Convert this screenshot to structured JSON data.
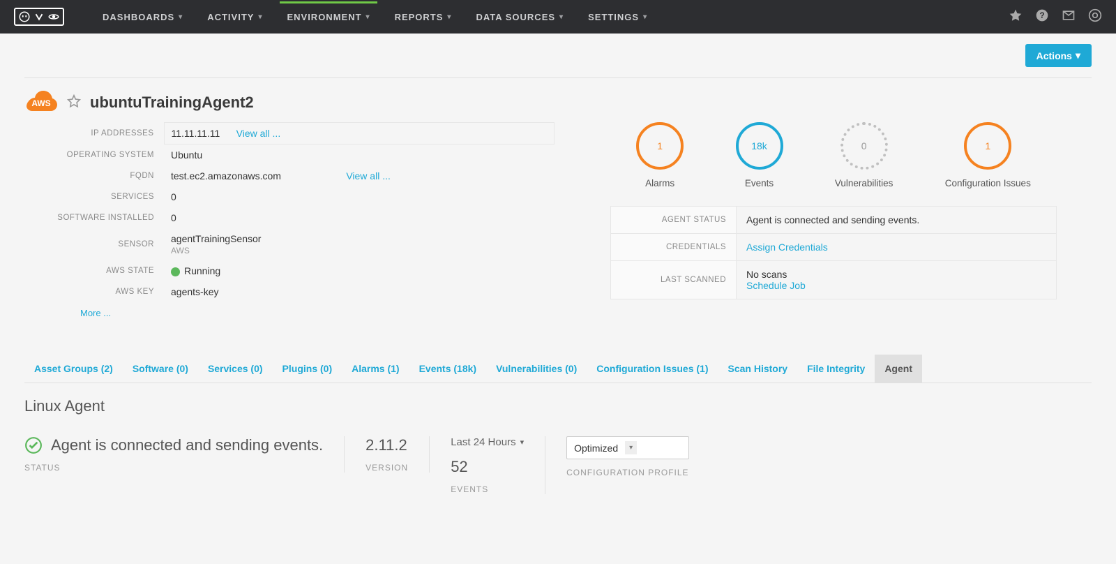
{
  "nav": {
    "items": [
      "DASHBOARDS",
      "ACTIVITY",
      "ENVIRONMENT",
      "REPORTS",
      "DATA SOURCES",
      "SETTINGS"
    ],
    "active": "ENVIRONMENT"
  },
  "actions_label": "Actions",
  "asset": {
    "name": "ubuntuTrainingAgent2",
    "cloud_badge": "AWS",
    "details": {
      "ip_label": "IP ADDRESSES",
      "ip_value": "11.11.11.11",
      "ip_viewall": "View all ...",
      "os_label": "OPERATING SYSTEM",
      "os_value": "Ubuntu",
      "fqdn_label": "FQDN",
      "fqdn_value": "test.ec2.amazonaws.com",
      "fqdn_viewall": "View all ...",
      "services_label": "SERVICES",
      "services_value": "0",
      "software_label": "SOFTWARE INSTALLED",
      "software_value": "0",
      "sensor_label": "SENSOR",
      "sensor_value": "agentTrainingSensor",
      "sensor_sub": "AWS",
      "awsstate_label": "AWS STATE",
      "awsstate_value": "Running",
      "awskey_label": "AWS KEY",
      "awskey_value": "agents-key",
      "more": "More ..."
    }
  },
  "rings": {
    "alarms": {
      "value": "1",
      "label": "Alarms"
    },
    "events": {
      "value": "18k",
      "label": "Events"
    },
    "vulns": {
      "value": "0",
      "label": "Vulnerabilities"
    },
    "config": {
      "value": "1",
      "label": "Configuration Issues"
    }
  },
  "status_table": {
    "agent_status_label": "AGENT STATUS",
    "agent_status_value": "Agent is connected and sending events.",
    "credentials_label": "CREDENTIALS",
    "credentials_link": "Assign Credentials",
    "lastscanned_label": "LAST SCANNED",
    "lastscanned_value": "No scans",
    "lastscanned_link": "Schedule Job"
  },
  "tabs": [
    {
      "label": "Asset Groups (2)"
    },
    {
      "label": "Software (0)"
    },
    {
      "label": "Services (0)"
    },
    {
      "label": "Plugins (0)"
    },
    {
      "label": "Alarms (1)"
    },
    {
      "label": "Events (18k)"
    },
    {
      "label": "Vulnerabilities (0)"
    },
    {
      "label": "Configuration Issues (1)"
    },
    {
      "label": "Scan History"
    },
    {
      "label": "File Integrity"
    },
    {
      "label": "Agent"
    }
  ],
  "active_tab": "Agent",
  "agent_panel": {
    "title": "Linux Agent",
    "status_text": "Agent is connected and sending events.",
    "status_caption": "STATUS",
    "version": "2.11.2",
    "version_caption": "VERSION",
    "time_range": "Last 24 Hours",
    "events_count": "52",
    "events_caption": "EVENTS",
    "profile_value": "Optimized",
    "profile_caption": "CONFIGURATION PROFILE"
  }
}
